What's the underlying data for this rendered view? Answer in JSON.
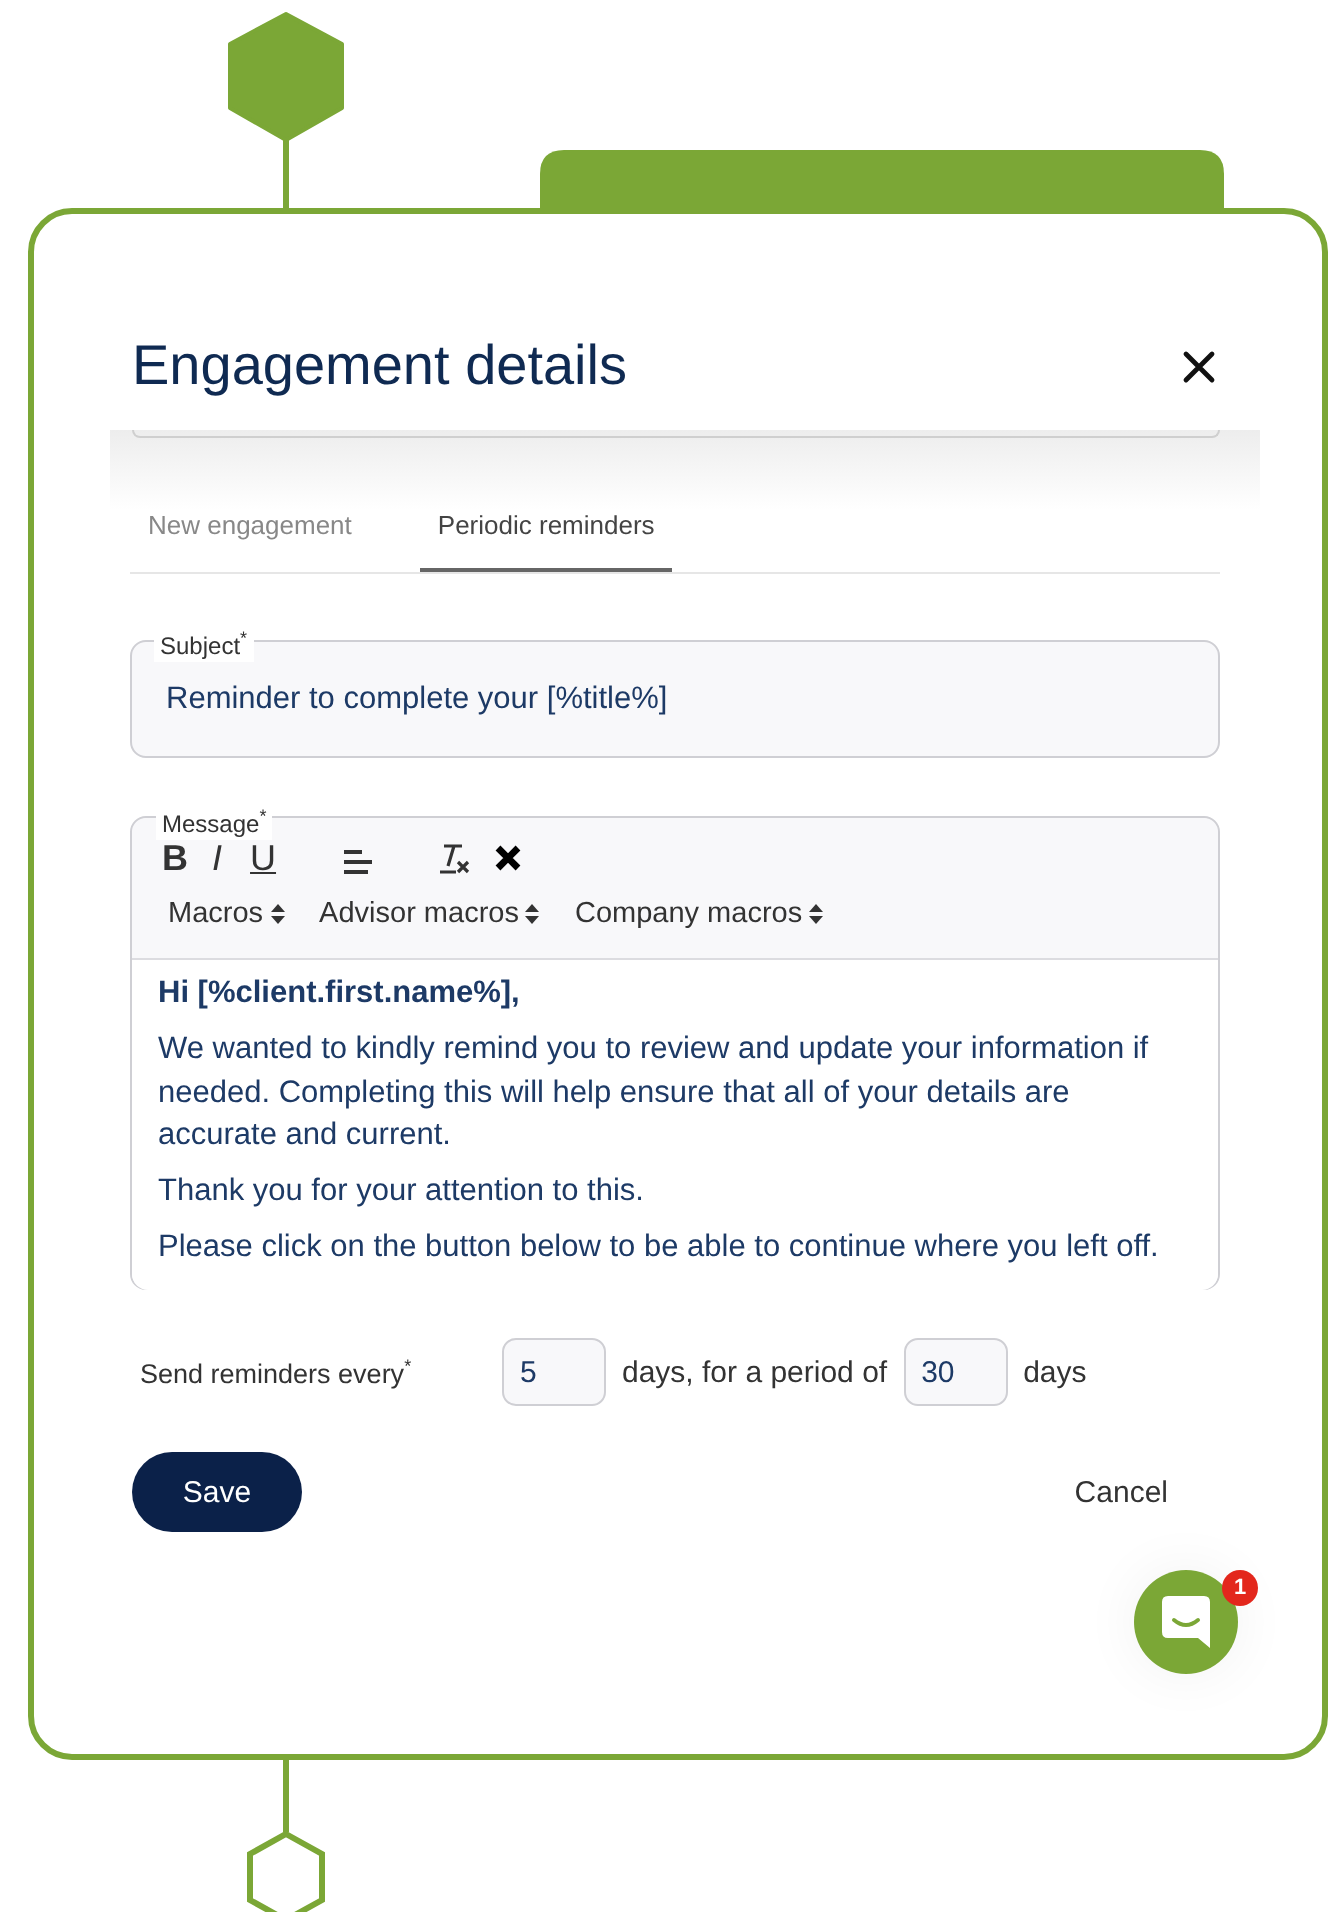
{
  "dialog": {
    "title": "Engagement details"
  },
  "tabs": [
    {
      "label": "New engagement",
      "selected": false
    },
    {
      "label": "Periodic reminders",
      "selected": true
    }
  ],
  "subject": {
    "label": "Subject$^{*}$",
    "value": "Reminder to complete your [%title%]"
  },
  "message": {
    "label": "Message$^{*}$",
    "toolbar": [
      {
        "kind": "bold",
        "label": "B"
      },
      {
        "kind": "italic",
        "label": "I"
      },
      {
        "kind": "underline",
        "label": "U"
      },
      {
        "kind": "align"
      },
      {
        "kind": "clear-format"
      },
      {
        "kind": "remove"
      }
    ],
    "macros": [
      "Macros",
      "Advisor macros",
      "Company macros"
    ],
    "body": [
      {
        "kind": "greeting",
        "text": "Hi [%client.first.name%],"
      },
      {
        "kind": "paragraph",
        "text": "We wanted to kindly remind you to review and update your information if needed. Completing this will help ensure that all of your details are accurate and current."
      },
      {
        "kind": "paragraph",
        "text": "Thank you for your attention to this."
      },
      {
        "kind": "paragraph",
        "text": "Please click on the button below to be able to continue where you left off."
      }
    ]
  },
  "reminders": {
    "label": "Send reminders every$^{*}$",
    "interval": "5",
    "interval_unit": "days, for a period of",
    "period": "30",
    "period_unit": "days"
  },
  "buttons": [
    {
      "kind": "primary",
      "label": "Save"
    },
    {
      "kind": "link",
      "label": "Cancel"
    }
  ],
  "chat": {
    "badge": "1"
  }
}
